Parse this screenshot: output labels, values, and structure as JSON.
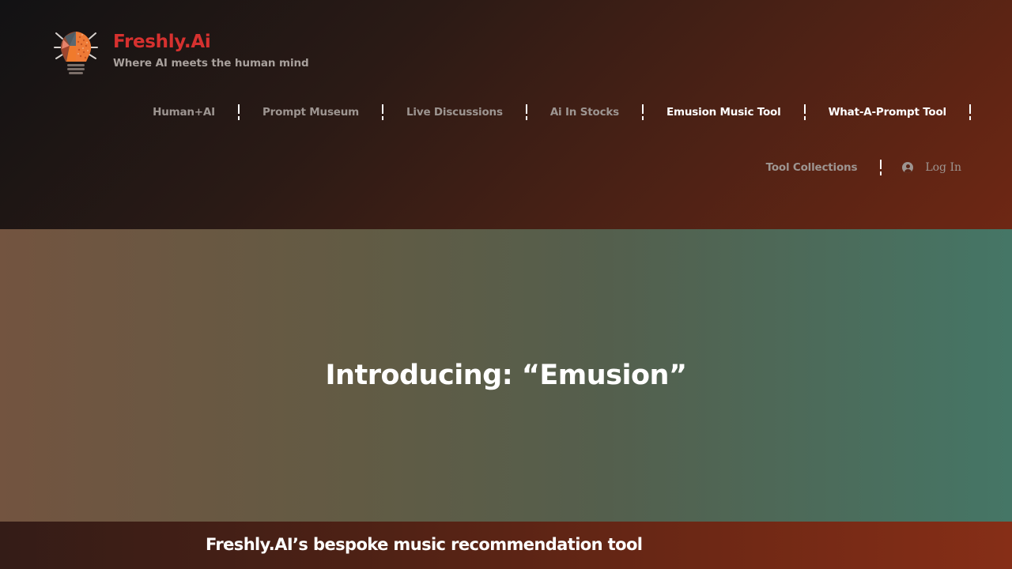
{
  "brand": {
    "title": "Freshly.Ai",
    "tagline": "Where AI meets the human mind",
    "logo_icon": "lightbulb-brain-icon",
    "title_color": "#d6312f"
  },
  "nav": {
    "row1": [
      {
        "label": "Human+AI",
        "active": false
      },
      {
        "label": "Prompt Museum",
        "active": false
      },
      {
        "label": "Live Discussions",
        "active": false
      },
      {
        "label": "Ai In Stocks",
        "active": false
      },
      {
        "label": "Emusion Music Tool",
        "active": true
      },
      {
        "label": "What-A-Prompt Tool",
        "active": true
      }
    ],
    "row2": [
      {
        "label": "Tool Collections",
        "active": false
      }
    ],
    "login": {
      "label": "Log In",
      "icon": "user-circle-icon"
    }
  },
  "hero": {
    "title": "Introducing: “Emusion”"
  },
  "subbar": {
    "title": "Freshly.AI’s bespoke music recommendation tool"
  }
}
